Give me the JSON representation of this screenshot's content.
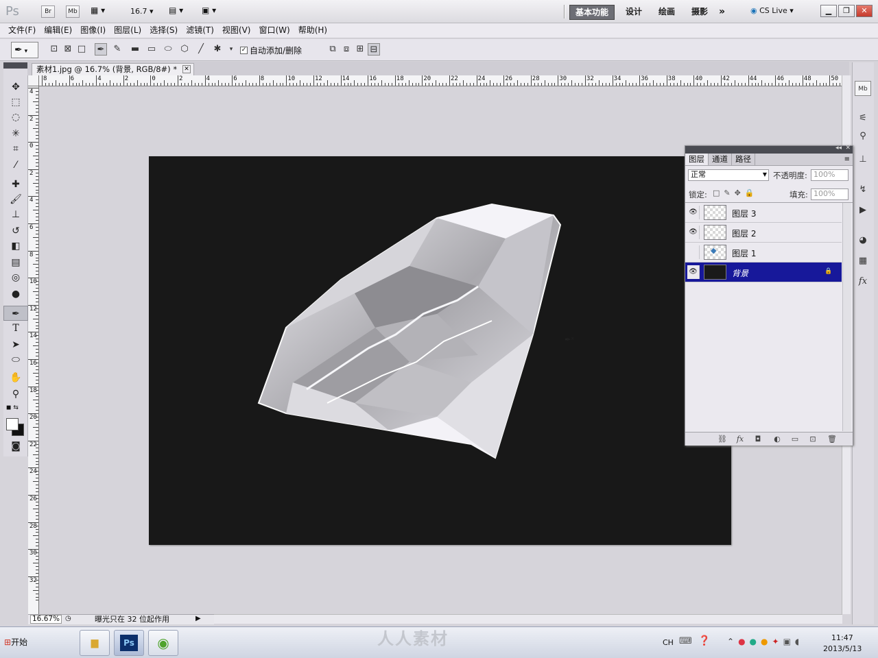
{
  "app": {
    "logo": "Ps",
    "bridge_label": "Br",
    "minibridge_label": "Mb",
    "zoom_value": "16.7",
    "workspaces": [
      "基本功能",
      "设计",
      "绘画",
      "摄影"
    ],
    "cslive_label": "CS Live"
  },
  "menu": [
    "文件(F)",
    "编辑(E)",
    "图像(I)",
    "图层(L)",
    "选择(S)",
    "滤镜(T)",
    "视图(V)",
    "窗口(W)",
    "帮助(H)"
  ],
  "options": {
    "auto_add_delete": "自动添加/删除",
    "auto_add_checked": true
  },
  "document": {
    "tab_title": "素材1.jpg @ 16.7% (背景, RGB/8#) *",
    "canvas_color": "#181818"
  },
  "rulers": {
    "top_labels": [
      "8",
      "6",
      "4",
      "2",
      "0",
      "2",
      "4",
      "6",
      "8",
      "10",
      "12",
      "14",
      "16",
      "18",
      "20",
      "22",
      "24",
      "26",
      "28",
      "30",
      "32",
      "34",
      "36",
      "38",
      "40",
      "42",
      "44",
      "46",
      "48",
      "50"
    ],
    "left_labels": [
      "4",
      "2",
      "0",
      "2",
      "4",
      "6",
      "8",
      "10",
      "12",
      "14",
      "16",
      "18",
      "20",
      "22",
      "24",
      "26",
      "28",
      "30",
      "32"
    ]
  },
  "status": {
    "zoom": "16.67%",
    "message": "曝光只在 32 位起作用"
  },
  "layers_panel": {
    "tabs": [
      "图层",
      "通道",
      "路径"
    ],
    "blend_mode": "正常",
    "opacity_label": "不透明度:",
    "opacity_value": "100%",
    "lock_label": "锁定:",
    "fill_label": "填充:",
    "fill_value": "100%",
    "layers": [
      {
        "name": "图层 3",
        "visible": true,
        "selected": false
      },
      {
        "name": "图层 2",
        "visible": true,
        "selected": false
      },
      {
        "name": "图层 1",
        "visible": false,
        "selected": false
      },
      {
        "name": "背景",
        "visible": true,
        "selected": true
      }
    ]
  },
  "taskbar": {
    "start_label": "开始",
    "ps_label": "Ps",
    "lang": "CH",
    "time": "11:47",
    "date": "2013/5/13",
    "watermark": "人人素材"
  }
}
